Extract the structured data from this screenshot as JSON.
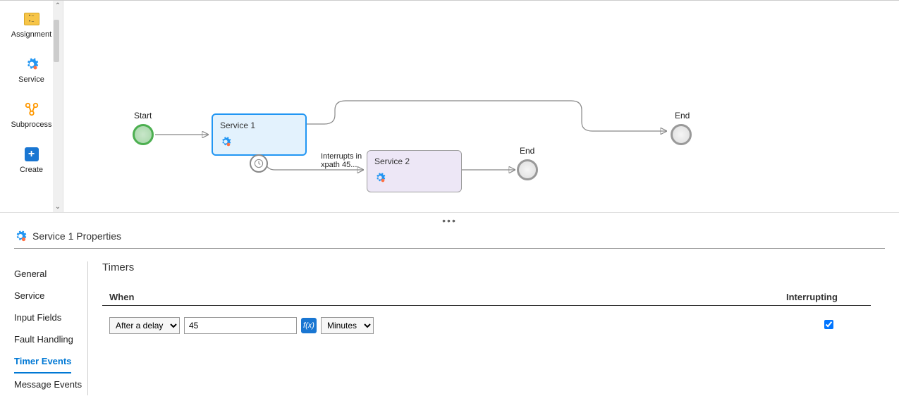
{
  "palette": {
    "items": [
      {
        "label": "Assignment"
      },
      {
        "label": "Service"
      },
      {
        "label": "Subprocess"
      },
      {
        "label": "Create"
      }
    ]
  },
  "diagram": {
    "start_label": "Start",
    "end1_label": "End",
    "end2_label": "End",
    "service1_label": "Service 1",
    "service2_label": "Service 2",
    "timer_label": "Interrupts in\nxpath 45..."
  },
  "properties": {
    "title": "Service 1 Properties",
    "tabs": [
      {
        "label": "General"
      },
      {
        "label": "Service"
      },
      {
        "label": "Input Fields"
      },
      {
        "label": "Fault Handling"
      },
      {
        "label": "Timer Events"
      },
      {
        "label": "Message Events"
      }
    ],
    "section_title": "Timers",
    "columns": {
      "when": "When",
      "interrupting": "Interrupting"
    },
    "row": {
      "when_option": "After a delay",
      "value": "45",
      "unit": "Minutes",
      "interrupting": true
    }
  }
}
